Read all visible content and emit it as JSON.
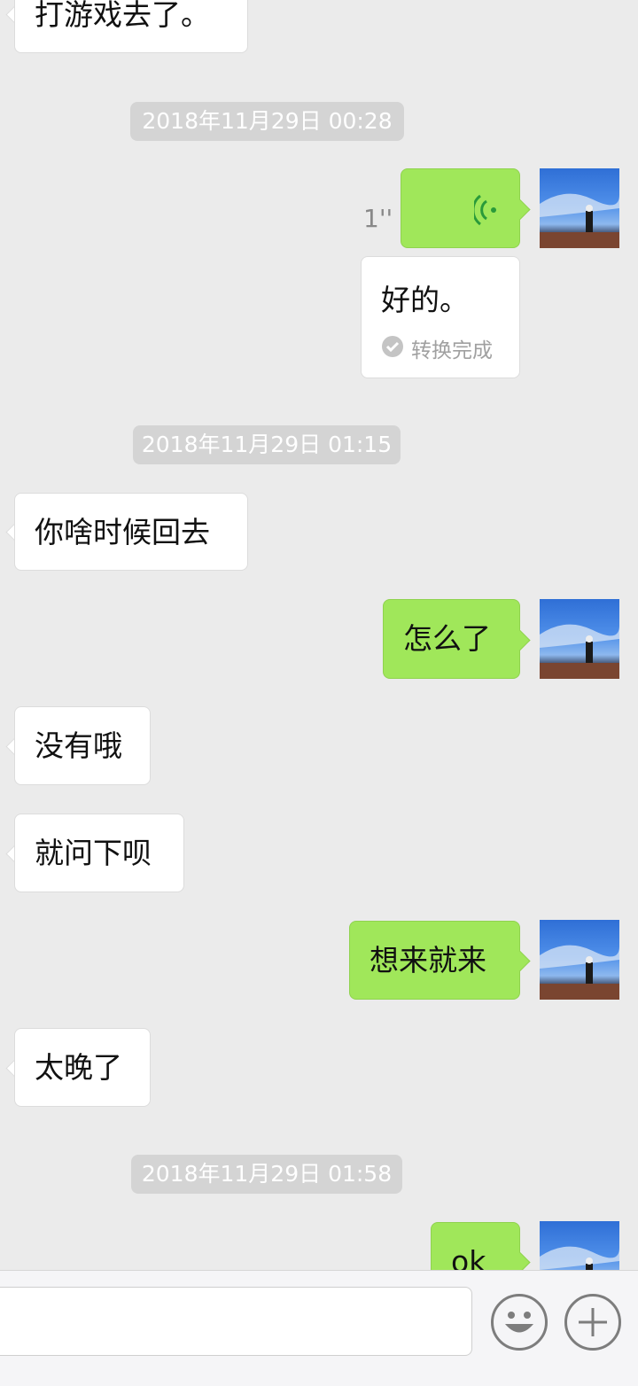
{
  "colors": {
    "background": "#ebebeb",
    "incoming_bubble": "#ffffff",
    "outgoing_bubble": "#a0e75a",
    "timestamp_bg": "#d4d4d4",
    "voice_icon": "#2a9a3a"
  },
  "messages": {
    "m0_text": "打游戏去了。",
    "ts1": "2018年11月29日 00:28",
    "voice_duration": "1''",
    "voice_transcript": "好的。",
    "transcript_status": "转换完成",
    "ts2": "2018年11月29日 01:15",
    "m2_text": "你啥时候回去",
    "m3_text": "怎么了",
    "m4_text": "没有哦",
    "m5_text": "就问下呗",
    "m6_text": "想来就来",
    "m7_text": "太晚了",
    "ts3": "2018年11月29日 01:58",
    "m8_text": "ok"
  },
  "icons": {
    "voice": "voice-wave-icon",
    "check": "check-circle-icon",
    "emoji": "emoji-icon",
    "plus": "plus-icon",
    "avatar": "avatar-photo"
  }
}
